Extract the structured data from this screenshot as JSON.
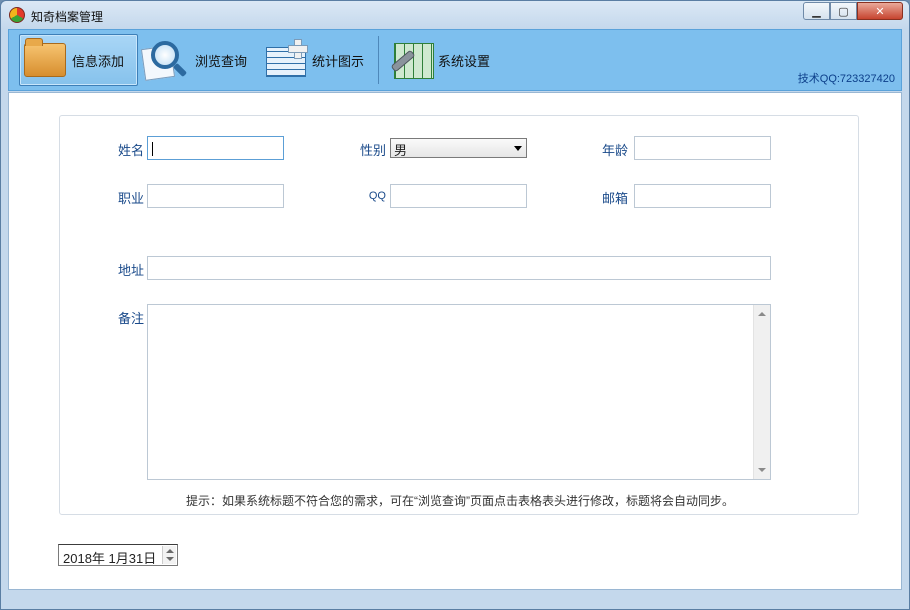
{
  "window": {
    "title": "知奇档案管理"
  },
  "toolbar": {
    "buttons": [
      {
        "label": "信息添加"
      },
      {
        "label": "浏览查询"
      },
      {
        "label": "统计图示"
      },
      {
        "label": "系统设置"
      }
    ],
    "tech_contact": "技术QQ:723327420"
  },
  "form": {
    "name_label": "姓名",
    "name_value": "",
    "gender_label": "性别",
    "gender_value": "男",
    "age_label": "年龄",
    "age_value": "",
    "job_label": "职业",
    "job_value": "",
    "qq_label": "QQ",
    "qq_value": "",
    "email_label": "邮箱",
    "email_value": "",
    "address_label": "地址",
    "address_value": "",
    "notes_label": "备注",
    "notes_value": "",
    "hint": "提示：如果系统标题不符合您的需求，可在“浏览查询”页面点击表格表头进行修改，标题将会自动同步。"
  },
  "date_picker": {
    "value": "2018年 1月31日"
  },
  "colors": {
    "toolbar_bg": "#7dbfee",
    "label_text": "#1a4a8a",
    "window_frame": "#c4d8ec"
  }
}
